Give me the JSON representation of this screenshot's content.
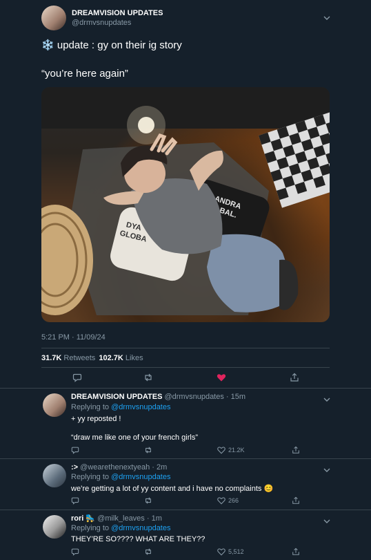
{
  "main_tweet": {
    "display_name": "DREAMVISION UPDATES",
    "handle": "@drmvsnupdates",
    "text_line1": "update : gy on their ig story",
    "text_line1_emoji": "❄️",
    "text_line2": "“you’re here again”",
    "photo_texts": {
      "pillow_left": "DYA\nGLOBA",
      "pillow_right": "ANDRA\nBAL."
    },
    "timestamp": "5:21 PM · 11/09/24",
    "retweets_count": "31.7K",
    "retweets_label": "Retweets",
    "likes_count": "102.7K",
    "likes_label": "Likes",
    "like_color": "#e0245e"
  },
  "replies": [
    {
      "display_name": "DREAMVISION UPDATES",
      "handle_time": "@drmvsnupdates · 15m",
      "replying_to_prefix": "Replying to",
      "replying_to_handle": "@drmvsnupdates",
      "text_line1": "+ yy reposted !",
      "text_line2": "“draw me like one of your french girls”",
      "likes": "21.2K"
    },
    {
      "display_name": ":>",
      "handle_time": "@wearethenextyeah · 2m",
      "replying_to_prefix": "Replying to",
      "replying_to_handle": "@drmvsnupdates",
      "text_line1": "we’re getting a lot of yy content and i have no complaints 😊",
      "likes": "266"
    },
    {
      "display_name": "rori",
      "name_emoji": "🛼",
      "handle_time": "@milk_leaves · 1m",
      "replying_to_prefix": "Replying to",
      "replying_to_handle": "@drmvsnupdates",
      "text_line1": "THEY’RE SO???? WHAT ARE THEY??",
      "likes": "5,512"
    }
  ]
}
